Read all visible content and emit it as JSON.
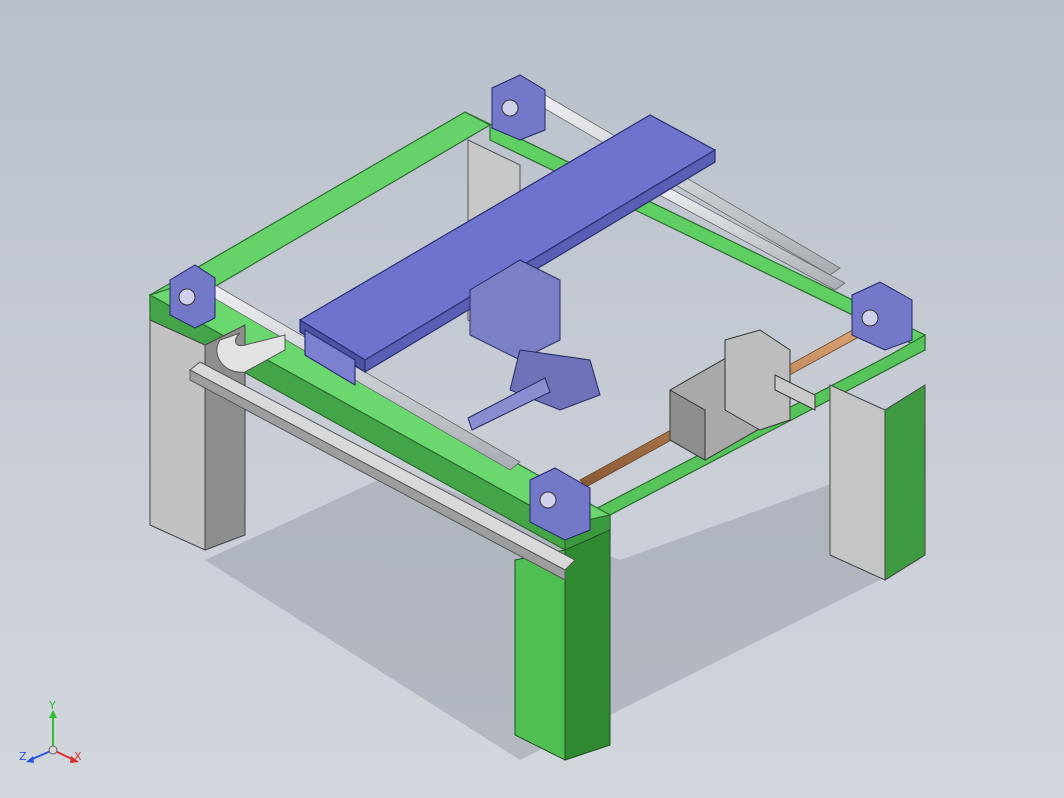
{
  "viewport": {
    "background_top": "#b9c0cb",
    "background_bottom": "#d2d6dd"
  },
  "model": {
    "frame_color": "#5fcf63",
    "frame_edge": "#2c6b2d",
    "leg_gray": "#b4b4b4",
    "carriage_color": "#6f74c9",
    "motor_color": "#7b7fbd",
    "rail_color": "#d4d6da",
    "screw_color": "#c08a5b"
  },
  "triad": {
    "y_label": "Y",
    "z_label": "Z",
    "x_label": "X",
    "y_color": "#2fbf2f",
    "z_color": "#2a55d8",
    "x_color": "#d83030"
  }
}
